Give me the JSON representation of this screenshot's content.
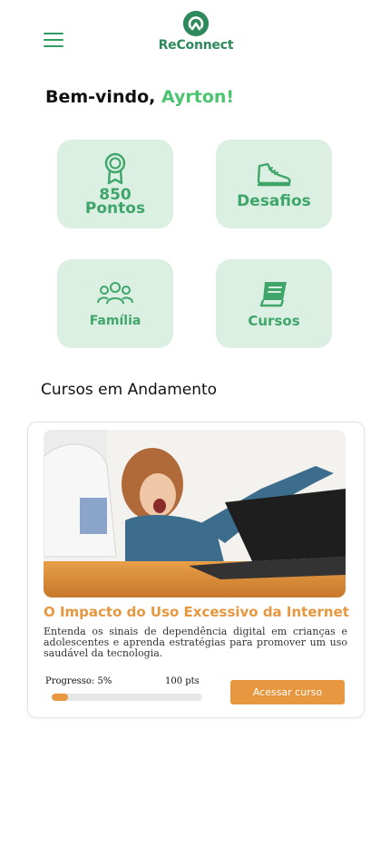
{
  "header": {
    "menu_icon": "hamburger-menu-icon",
    "logo_text": "ReConnect",
    "logo_icon": "reconnect-logo-icon"
  },
  "welcome": {
    "greeting": "Bem-vindo,",
    "name": "Ayrton!"
  },
  "tiles": [
    {
      "icon": "award-medal-icon",
      "line1": "850",
      "line2": "Pontos"
    },
    {
      "icon": "sneaker-icon",
      "label": "Desafios"
    },
    {
      "icon": "family-group-icon",
      "label": "Família"
    },
    {
      "icon": "book-icon",
      "label": "Cursos"
    }
  ],
  "in_progress": {
    "section_title": "Cursos em Andamento",
    "course": {
      "image_alt": "illustration-girl-pulled-away-from-laptop",
      "title": "O Impacto do Uso Excessivo da Internet",
      "description": "Entenda os sinais de dependência digital em crianças e adolescentes e aprenda estratégias para promover um uso saudável da tecnologia.",
      "progress_label": "Progresso: 5%",
      "progress_value": 5,
      "points_label": "100 pts",
      "button_label": "Acessar curso"
    }
  },
  "colors": {
    "brand_green": "#2e8a5c",
    "accent_green": "#4cc46f",
    "tile_bg": "#dcefe3",
    "accent_orange": "#e6973f"
  }
}
